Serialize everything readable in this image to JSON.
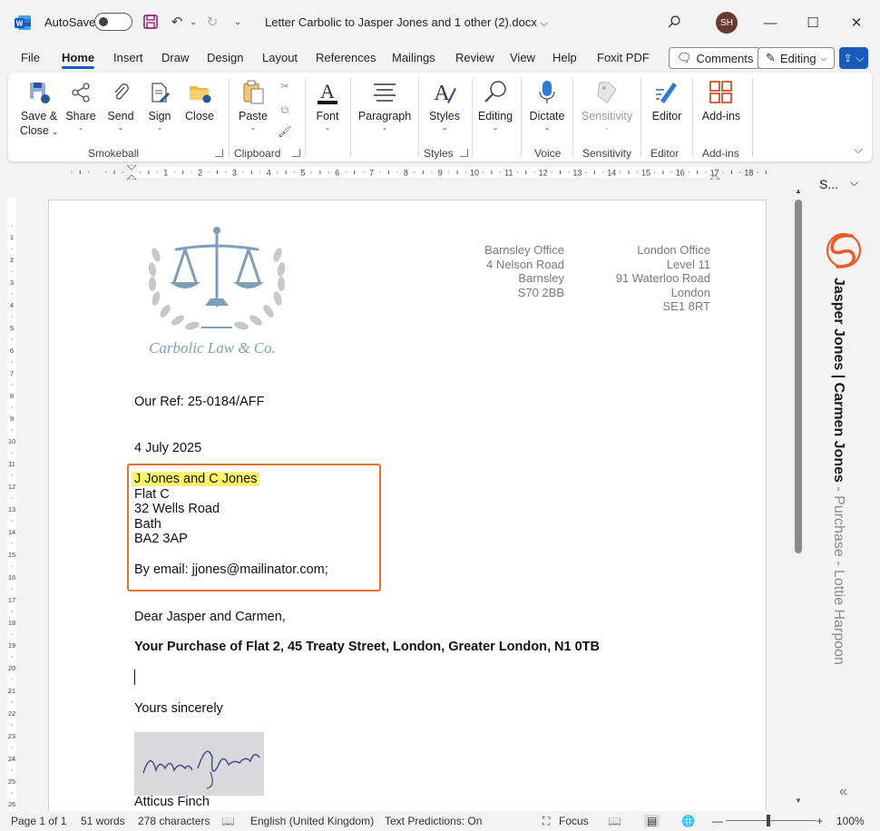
{
  "titlebar": {
    "autosave_label": "AutoSave",
    "doc_title": "Letter Carbolic to Jasper Jones and 1 other (2).docx",
    "avatar_initials": "SH"
  },
  "tabs": [
    "File",
    "Home",
    "Insert",
    "Draw",
    "Design",
    "Layout",
    "References",
    "Mailings",
    "Review",
    "View",
    "Help",
    "Foxit PDF"
  ],
  "active_tab": "Home",
  "actions": {
    "comments": "Comments",
    "editing": "Editing"
  },
  "ribbon": {
    "save_close": "Save &",
    "save_close2": "Close",
    "share": "Share",
    "send": "Send",
    "sign": "Sign",
    "close": "Close",
    "paste": "Paste",
    "font": "Font",
    "paragraph": "Paragraph",
    "styles": "Styles",
    "editing": "Editing",
    "dictate": "Dictate",
    "sensitivity": "Sensitivity",
    "editor": "Editor",
    "addins": "Add-ins",
    "groups": {
      "smokeball": "Smokeball",
      "clipboard": "Clipboard",
      "styles": "Styles",
      "voice": "Voice",
      "sensitivity": "Sensitivity",
      "editor": "Editor",
      "addins": "Add-ins"
    }
  },
  "ruler_numbers": [
    "1",
    "2",
    "3",
    "4",
    "5",
    "6",
    "7",
    "8",
    "9",
    "10",
    "11",
    "12",
    "13",
    "14",
    "15",
    "16",
    "17",
    "18"
  ],
  "vruler_numbers": [
    "1",
    "2",
    "3",
    "4",
    "5",
    "6",
    "7",
    "8",
    "9",
    "10",
    "11",
    "12",
    "13",
    "14",
    "15",
    "16",
    "17",
    "18",
    "19",
    "20",
    "21",
    "22",
    "23",
    "24",
    "25",
    "26"
  ],
  "letterhead": {
    "firm_name": "Carbolic Law & Co.",
    "barnsley": [
      "Barnsley Office",
      "4 Nelson Road",
      "Barnsley",
      "S70 2BB"
    ],
    "london": [
      "London Office",
      "Level 11",
      "91 Waterloo Road",
      "London",
      "SE1 8RT"
    ]
  },
  "letter": {
    "our_ref": "Our Ref: 25-0184/AFF",
    "date": "4 July 2025",
    "recipient": "J Jones and C Jones",
    "address": [
      "Flat C",
      "32 Wells Road",
      "Bath",
      "BA2 3AP"
    ],
    "by_email": "By email: jjones@mailinator.com;",
    "salutation": "Dear Jasper and Carmen,",
    "subject": "Your Purchase of Flat 2, 45 Treaty Street, London, Greater London, N1 0TB",
    "closing": "Yours sincerely",
    "signatory": "Atticus Finch"
  },
  "side_pane": {
    "header": "S...",
    "matter_bold": "Jasper Jones | Carmen Jones",
    "matter_light": " - Purchase - Lottie Harpoon"
  },
  "statusbar": {
    "page": "Page 1 of 1",
    "words": "51 words",
    "characters": "278 characters",
    "language": "English (United Kingdom)",
    "text_predictions": "Text Predictions: On",
    "focus": "Focus",
    "zoom": "100%"
  },
  "colors": {
    "accent": "#185abd",
    "highlight": "#fff76a",
    "address_box": "#ea7030",
    "logo_blue": "#7f9fb8",
    "smokeball_orange": "#f05a28"
  }
}
